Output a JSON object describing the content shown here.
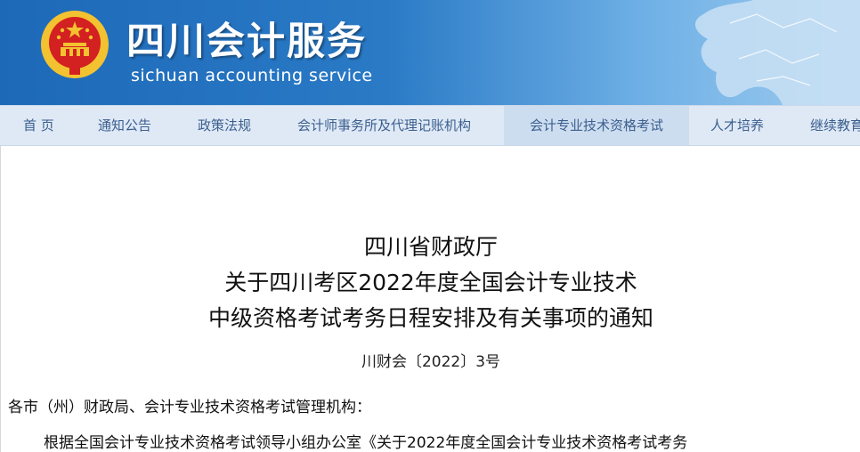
{
  "header": {
    "title": "四川会计服务",
    "subtitle": "sichuan accounting service"
  },
  "nav": {
    "items": [
      {
        "label": "首 页"
      },
      {
        "label": "通知公告"
      },
      {
        "label": "政策法规"
      },
      {
        "label": "会计师事务所及代理记账机构"
      },
      {
        "label": "会计专业技术资格考试",
        "active": true
      },
      {
        "label": "人才培养"
      },
      {
        "label": "继续教育"
      }
    ]
  },
  "article": {
    "title_line1": "四川省财政厅",
    "title_line2": "关于四川考区2022年度全国会计专业技术",
    "title_line3": "中级资格考试考务日程安排及有关事项的通知",
    "doc_number": "川财会〔2022〕3号",
    "salutation": "各市（州）财政局、会计专业技术资格考试管理机构：",
    "body_start": "根据全国会计专业技术资格考试领导小组办公室《关于2022年度全国会计专业技术资格考试考务"
  },
  "colors": {
    "header_blue": "#1d69b8",
    "nav_background": "#dfe9f6",
    "nav_text": "#3b5f8e",
    "nav_active": "#cdddf0",
    "emblem_red": "#d32020",
    "emblem_gold": "#f2c230"
  },
  "icons": {
    "emblem": "national-emblem-icon",
    "map": "sichuan-map-icon"
  }
}
